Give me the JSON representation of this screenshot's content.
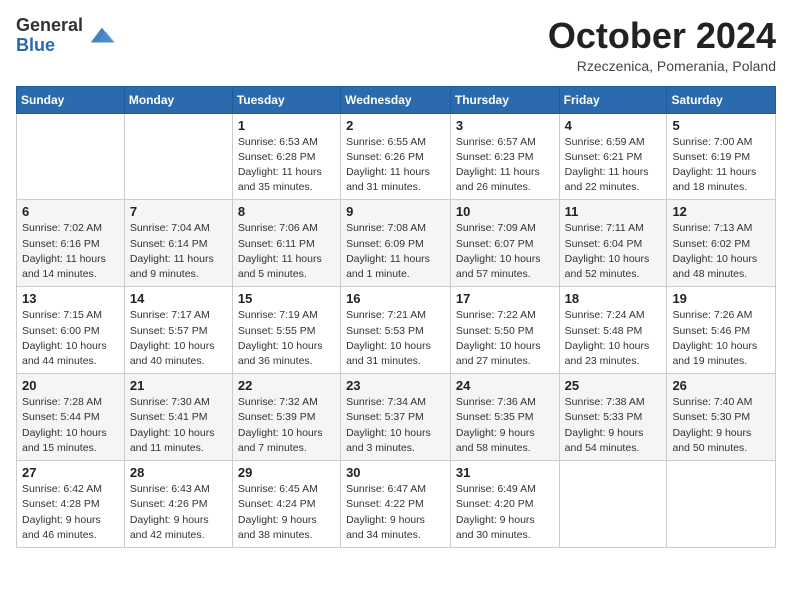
{
  "header": {
    "logo_general": "General",
    "logo_blue": "Blue",
    "month_title": "October 2024",
    "location": "Rzeczenica, Pomerania, Poland"
  },
  "days_of_week": [
    "Sunday",
    "Monday",
    "Tuesday",
    "Wednesday",
    "Thursday",
    "Friday",
    "Saturday"
  ],
  "weeks": [
    [
      {
        "day": "",
        "sunrise": "",
        "sunset": "",
        "daylight": ""
      },
      {
        "day": "",
        "sunrise": "",
        "sunset": "",
        "daylight": ""
      },
      {
        "day": "1",
        "sunrise": "Sunrise: 6:53 AM",
        "sunset": "Sunset: 6:28 PM",
        "daylight": "Daylight: 11 hours and 35 minutes."
      },
      {
        "day": "2",
        "sunrise": "Sunrise: 6:55 AM",
        "sunset": "Sunset: 6:26 PM",
        "daylight": "Daylight: 11 hours and 31 minutes."
      },
      {
        "day": "3",
        "sunrise": "Sunrise: 6:57 AM",
        "sunset": "Sunset: 6:23 PM",
        "daylight": "Daylight: 11 hours and 26 minutes."
      },
      {
        "day": "4",
        "sunrise": "Sunrise: 6:59 AM",
        "sunset": "Sunset: 6:21 PM",
        "daylight": "Daylight: 11 hours and 22 minutes."
      },
      {
        "day": "5",
        "sunrise": "Sunrise: 7:00 AM",
        "sunset": "Sunset: 6:19 PM",
        "daylight": "Daylight: 11 hours and 18 minutes."
      }
    ],
    [
      {
        "day": "6",
        "sunrise": "Sunrise: 7:02 AM",
        "sunset": "Sunset: 6:16 PM",
        "daylight": "Daylight: 11 hours and 14 minutes."
      },
      {
        "day": "7",
        "sunrise": "Sunrise: 7:04 AM",
        "sunset": "Sunset: 6:14 PM",
        "daylight": "Daylight: 11 hours and 9 minutes."
      },
      {
        "day": "8",
        "sunrise": "Sunrise: 7:06 AM",
        "sunset": "Sunset: 6:11 PM",
        "daylight": "Daylight: 11 hours and 5 minutes."
      },
      {
        "day": "9",
        "sunrise": "Sunrise: 7:08 AM",
        "sunset": "Sunset: 6:09 PM",
        "daylight": "Daylight: 11 hours and 1 minute."
      },
      {
        "day": "10",
        "sunrise": "Sunrise: 7:09 AM",
        "sunset": "Sunset: 6:07 PM",
        "daylight": "Daylight: 10 hours and 57 minutes."
      },
      {
        "day": "11",
        "sunrise": "Sunrise: 7:11 AM",
        "sunset": "Sunset: 6:04 PM",
        "daylight": "Daylight: 10 hours and 52 minutes."
      },
      {
        "day": "12",
        "sunrise": "Sunrise: 7:13 AM",
        "sunset": "Sunset: 6:02 PM",
        "daylight": "Daylight: 10 hours and 48 minutes."
      }
    ],
    [
      {
        "day": "13",
        "sunrise": "Sunrise: 7:15 AM",
        "sunset": "Sunset: 6:00 PM",
        "daylight": "Daylight: 10 hours and 44 minutes."
      },
      {
        "day": "14",
        "sunrise": "Sunrise: 7:17 AM",
        "sunset": "Sunset: 5:57 PM",
        "daylight": "Daylight: 10 hours and 40 minutes."
      },
      {
        "day": "15",
        "sunrise": "Sunrise: 7:19 AM",
        "sunset": "Sunset: 5:55 PM",
        "daylight": "Daylight: 10 hours and 36 minutes."
      },
      {
        "day": "16",
        "sunrise": "Sunrise: 7:21 AM",
        "sunset": "Sunset: 5:53 PM",
        "daylight": "Daylight: 10 hours and 31 minutes."
      },
      {
        "day": "17",
        "sunrise": "Sunrise: 7:22 AM",
        "sunset": "Sunset: 5:50 PM",
        "daylight": "Daylight: 10 hours and 27 minutes."
      },
      {
        "day": "18",
        "sunrise": "Sunrise: 7:24 AM",
        "sunset": "Sunset: 5:48 PM",
        "daylight": "Daylight: 10 hours and 23 minutes."
      },
      {
        "day": "19",
        "sunrise": "Sunrise: 7:26 AM",
        "sunset": "Sunset: 5:46 PM",
        "daylight": "Daylight: 10 hours and 19 minutes."
      }
    ],
    [
      {
        "day": "20",
        "sunrise": "Sunrise: 7:28 AM",
        "sunset": "Sunset: 5:44 PM",
        "daylight": "Daylight: 10 hours and 15 minutes."
      },
      {
        "day": "21",
        "sunrise": "Sunrise: 7:30 AM",
        "sunset": "Sunset: 5:41 PM",
        "daylight": "Daylight: 10 hours and 11 minutes."
      },
      {
        "day": "22",
        "sunrise": "Sunrise: 7:32 AM",
        "sunset": "Sunset: 5:39 PM",
        "daylight": "Daylight: 10 hours and 7 minutes."
      },
      {
        "day": "23",
        "sunrise": "Sunrise: 7:34 AM",
        "sunset": "Sunset: 5:37 PM",
        "daylight": "Daylight: 10 hours and 3 minutes."
      },
      {
        "day": "24",
        "sunrise": "Sunrise: 7:36 AM",
        "sunset": "Sunset: 5:35 PM",
        "daylight": "Daylight: 9 hours and 58 minutes."
      },
      {
        "day": "25",
        "sunrise": "Sunrise: 7:38 AM",
        "sunset": "Sunset: 5:33 PM",
        "daylight": "Daylight: 9 hours and 54 minutes."
      },
      {
        "day": "26",
        "sunrise": "Sunrise: 7:40 AM",
        "sunset": "Sunset: 5:30 PM",
        "daylight": "Daylight: 9 hours and 50 minutes."
      }
    ],
    [
      {
        "day": "27",
        "sunrise": "Sunrise: 6:42 AM",
        "sunset": "Sunset: 4:28 PM",
        "daylight": "Daylight: 9 hours and 46 minutes."
      },
      {
        "day": "28",
        "sunrise": "Sunrise: 6:43 AM",
        "sunset": "Sunset: 4:26 PM",
        "daylight": "Daylight: 9 hours and 42 minutes."
      },
      {
        "day": "29",
        "sunrise": "Sunrise: 6:45 AM",
        "sunset": "Sunset: 4:24 PM",
        "daylight": "Daylight: 9 hours and 38 minutes."
      },
      {
        "day": "30",
        "sunrise": "Sunrise: 6:47 AM",
        "sunset": "Sunset: 4:22 PM",
        "daylight": "Daylight: 9 hours and 34 minutes."
      },
      {
        "day": "31",
        "sunrise": "Sunrise: 6:49 AM",
        "sunset": "Sunset: 4:20 PM",
        "daylight": "Daylight: 9 hours and 30 minutes."
      },
      {
        "day": "",
        "sunrise": "",
        "sunset": "",
        "daylight": ""
      },
      {
        "day": "",
        "sunrise": "",
        "sunset": "",
        "daylight": ""
      }
    ]
  ]
}
